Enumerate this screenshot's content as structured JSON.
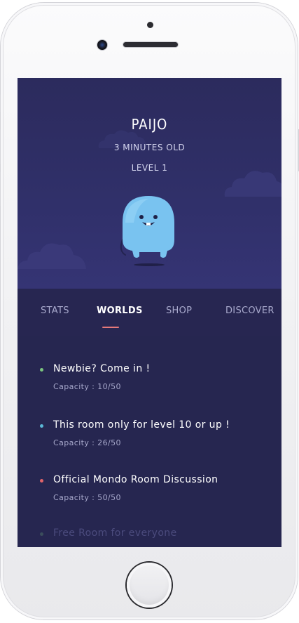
{
  "pet": {
    "name": "PAIJO",
    "age": "3 MINUTES OLD",
    "level": "LEVEL 1"
  },
  "tabs": [
    {
      "label": "Stats",
      "active": false
    },
    {
      "label": "Worlds",
      "active": true
    },
    {
      "label": "Shop",
      "active": false
    },
    {
      "label": "Discover",
      "active": false
    }
  ],
  "rooms": [
    {
      "title": "Newbie? Come in !",
      "capacity": "Capacity : 10/50",
      "status_color": "#7bc47f"
    },
    {
      "title": "This room only for level 10 or up !",
      "capacity": "Capacity : 26/50",
      "status_color": "#5bb8d6"
    },
    {
      "title": "Official Mondo Room Discussion",
      "capacity": "Capacity : 50/50",
      "status_color": "#e0646a"
    },
    {
      "title": "Free Room for everyone",
      "capacity": "",
      "status_color": "#7bc47f"
    }
  ],
  "colors": {
    "background": "#262650",
    "accent": "#e6797a",
    "pet_body": "#79c3f0"
  }
}
